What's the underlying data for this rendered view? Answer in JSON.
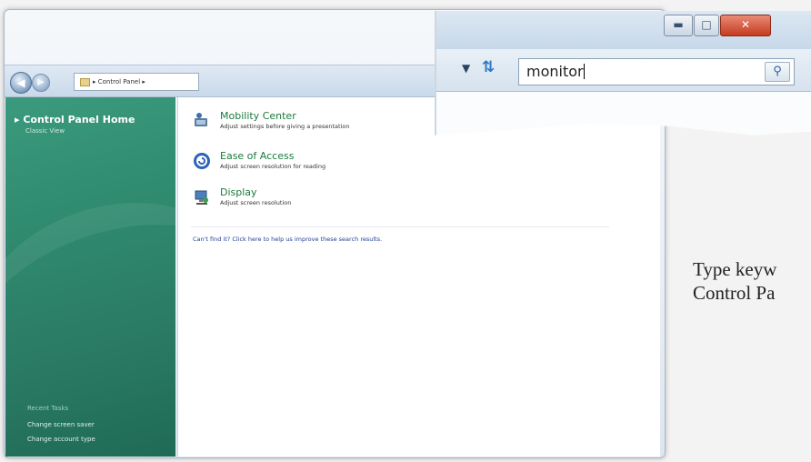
{
  "window": {
    "breadcrumb": "▸ Control Panel ▸"
  },
  "sidebar": {
    "home": "▸ Control Panel Home",
    "classic": "Classic View",
    "recent_tasks": "Recent Tasks",
    "tasks": [
      "Change screen saver",
      "Change account type"
    ]
  },
  "results": [
    {
      "title": "Mobility Center",
      "desc": "Adjust settings before giving a presentation",
      "icon": "mobility-center-icon"
    },
    {
      "title": "Ease of Access",
      "desc": "Adjust screen resolution for reading",
      "icon": "ease-of-access-icon"
    },
    {
      "title": "Display",
      "desc": "Adjust screen resolution",
      "icon": "display-icon"
    }
  ],
  "cant_find": "Can't find it? Click here to help us improve these search results.",
  "search": {
    "value": "monitor"
  },
  "caption": {
    "line1": "Type keyw",
    "line2": "Control Pa"
  },
  "colors": {
    "sidebar": "#2f8a6e",
    "link_green": "#1c7a3d",
    "close_red": "#c53b20"
  }
}
